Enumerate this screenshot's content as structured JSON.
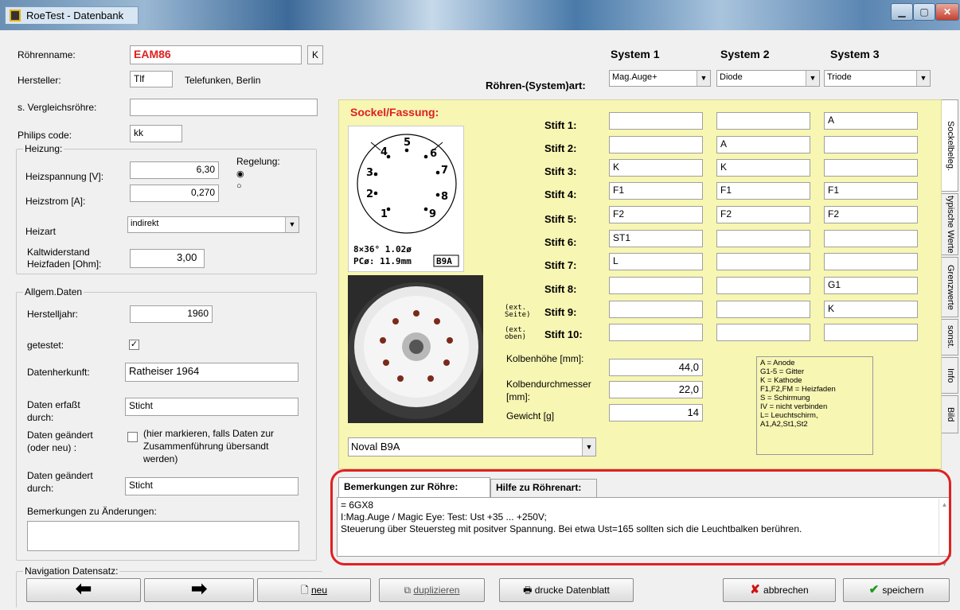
{
  "window": {
    "title": "RoeTest - Datenbank"
  },
  "left": {
    "roehrenname_label": "Röhrenname:",
    "roehrenname_value": "EAM86",
    "k_button": "K",
    "hersteller_label": "Hersteller:",
    "hersteller_code": "Tlf",
    "hersteller_name": "Telefunken, Berlin",
    "vergleich_label": "s. Vergleichsröhre:",
    "vergleich_value": "",
    "philips_label": "Philips code:",
    "philips_value": "kk"
  },
  "heizung": {
    "caption": "Heizung:",
    "spannung_label": "Heizspannung [V]:",
    "spannung_value": "6,30",
    "strom_label": "Heizstrom [A]:",
    "strom_value": "0,270",
    "regelung_label": "Regelung:",
    "art_label": "Heizart",
    "art_value": "indirekt",
    "kalt_label_1": "Kaltwiderstand",
    "kalt_label_2": "Heizfaden [Ohm]:",
    "kalt_value": "3,00"
  },
  "allgem": {
    "caption": "Allgem.Daten",
    "jahr_label": "Herstelljahr:",
    "jahr_value": "1960",
    "getestet_label": "getestet:",
    "getestet_check": "✓",
    "herkunft_label": "Datenherkunft:",
    "herkunft_value": "Ratheiser 1964",
    "erfasst_label_1": "Daten erfaßt",
    "erfasst_label_2": "durch:",
    "erfasst_value": "Sticht",
    "geaendert_label_1": "Daten geändert",
    "geaendert_label_2": "(oder neu) :",
    "markieren_1": "(hier markieren, falls Daten zur",
    "markieren_2": "Zusammenführung übersandt",
    "markieren_3": "werden)",
    "geaendert_durch_1": "Daten geändert",
    "geaendert_durch_2": "durch:",
    "geaendert_durch_value": "Sticht",
    "bem_aenderungen_label": "Bemerkungen zu Änderungen:"
  },
  "systems": {
    "art_label": "Röhren-(System)art:",
    "headers": [
      "System 1",
      "System 2",
      "System 3"
    ],
    "types": [
      "Mag.Auge+",
      "Diode",
      "Triode"
    ]
  },
  "sockel": {
    "title": "Sockel/Fassung:",
    "diagram_text_1": "8×36°  1.02ø",
    "diagram_text_2": "PCø: 11.9mm",
    "diagram_badge": "B9A",
    "pin_numbers": [
      "1",
      "2",
      "3",
      "4",
      "5",
      "6",
      "7",
      "8",
      "9"
    ],
    "stift_labels": [
      "Stift 1:",
      "Stift 2:",
      "Stift 3:",
      "Stift 4:",
      "Stift 5:",
      "Stift 6:",
      "Stift 7:",
      "Stift 8:",
      "Stift 9:",
      "Stift 10:"
    ],
    "ext_seite": "(ext. Seite)",
    "ext_oben": "(ext. oben)",
    "pins": [
      [
        "",
        "",
        "A"
      ],
      [
        "",
        "A",
        ""
      ],
      [
        "K",
        "K",
        ""
      ],
      [
        "F1",
        "F1",
        "F1"
      ],
      [
        "F2",
        "F2",
        "F2"
      ],
      [
        "ST1",
        "",
        ""
      ],
      [
        "L",
        "",
        ""
      ],
      [
        "",
        "",
        "G1"
      ],
      [
        "",
        "",
        "K"
      ],
      [
        "",
        "",
        ""
      ]
    ],
    "kolbenhoehe_label": "Kolbenhöhe [mm]:",
    "kolbenhoehe_value": "44,0",
    "kolbendm_label_1": "Kolbendurchmesser",
    "kolbendm_label_2": "[mm]:",
    "kolbendm_value": "22,0",
    "gewicht_label": "Gewicht [g]",
    "gewicht_value": "14",
    "socket_type": "Noval B9A",
    "legend": [
      "A = Anode",
      "G1-5 = Gitter",
      "K = Kathode",
      "F1,F2,FM = Heizfaden",
      "S = Schirmung",
      "IV = nicht verbinden",
      "L= Leuchtschirm,",
      "A1,A2,St1,St2"
    ]
  },
  "side_tabs": [
    "Sockelbeleg.",
    "typische Werte",
    "Grenzwerte",
    "sonst.",
    "Info",
    "Bild"
  ],
  "bemerkungen": {
    "tab1": "Bemerkungen zur Röhre:",
    "tab2": "Hilfe zu Röhrenart:",
    "line1": "= 6GX8",
    "line2": "I:Mag.Auge / Magic Eye: Test: Ust +35 ... +250V;",
    "line3": "Steuerung über Steuersteg mit positver Spannung. Bei etwa Ust=165 sollten sich die Leuchtbalken berühren."
  },
  "nav": {
    "caption": "Navigation Datensatz:",
    "neu": "neu",
    "duplizieren": "duplizieren",
    "drucke": "drucke Datenblatt",
    "abbrechen": "abbrechen",
    "speichern": "speichern"
  }
}
